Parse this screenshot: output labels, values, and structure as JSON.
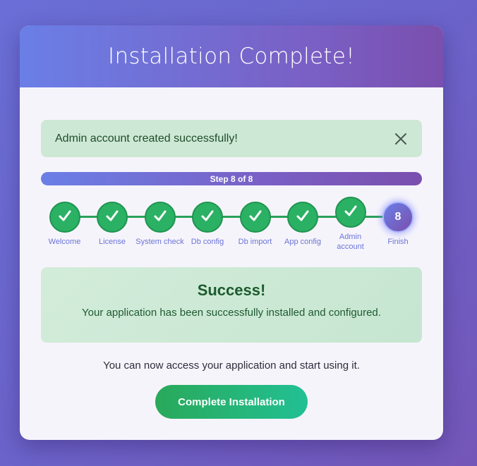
{
  "header": {
    "title": "Installation Complete!"
  },
  "alert": {
    "message": "Admin account created successfully!"
  },
  "progress": {
    "label": "Step 8 of 8",
    "current": 8,
    "total": 8
  },
  "steps": [
    {
      "label": "Welcome",
      "status": "done"
    },
    {
      "label": "License",
      "status": "done"
    },
    {
      "label": "System check",
      "status": "done"
    },
    {
      "label": "Db config",
      "status": "done"
    },
    {
      "label": "Db import",
      "status": "done"
    },
    {
      "label": "App config",
      "status": "done"
    },
    {
      "label": "Admin account",
      "status": "done"
    },
    {
      "label": "Finish",
      "status": "current",
      "number": "8"
    }
  ],
  "success": {
    "title": "Success!",
    "message": "Your application has been successfully installed and configured."
  },
  "access_message": "You can now access your application and start using it.",
  "complete_button": {
    "label": "Complete Installation"
  },
  "colors": {
    "accent_start": "#6a7fe6",
    "accent_end": "#7a4fae",
    "success_green": "#2bb164",
    "button_start": "#29a95a",
    "button_end": "#22c094"
  }
}
